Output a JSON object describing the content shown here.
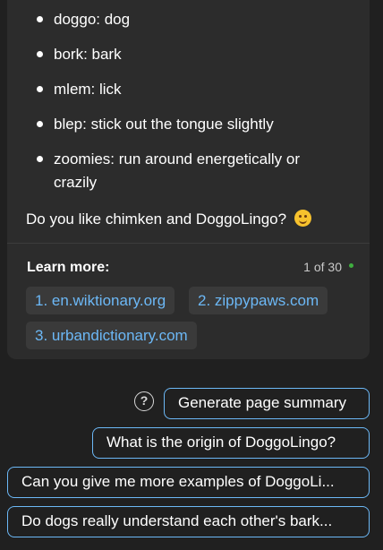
{
  "answer": {
    "bullets": [
      "doggo: dog",
      "bork: bark",
      "mlem: lick",
      "blep: stick out the tongue slightly",
      "zoomies: run around energetically or crazily"
    ],
    "closing_text": "Do you like chimken and DoggoLingo?",
    "closing_emoji": "smiling-face-emoji"
  },
  "learn_more": {
    "label": "Learn more:",
    "counter": "1 of 30",
    "status_color": "#3fae3f",
    "links": [
      "1. en.wiktionary.org",
      "2. zippypaws.com",
      "3. urbandictionary.com"
    ]
  },
  "suggestions": {
    "help_icon": "question-circle-icon",
    "items": [
      "Generate page summary",
      "What is the origin of DoggoLingo?",
      "Can you give me more examples of DoggoLi...",
      "Do dogs really understand each other's bark..."
    ]
  },
  "colors": {
    "background": "#202020",
    "card": "#2c2c2c",
    "link": "#6cb8f6",
    "accent_border": "#6cb8f6"
  }
}
